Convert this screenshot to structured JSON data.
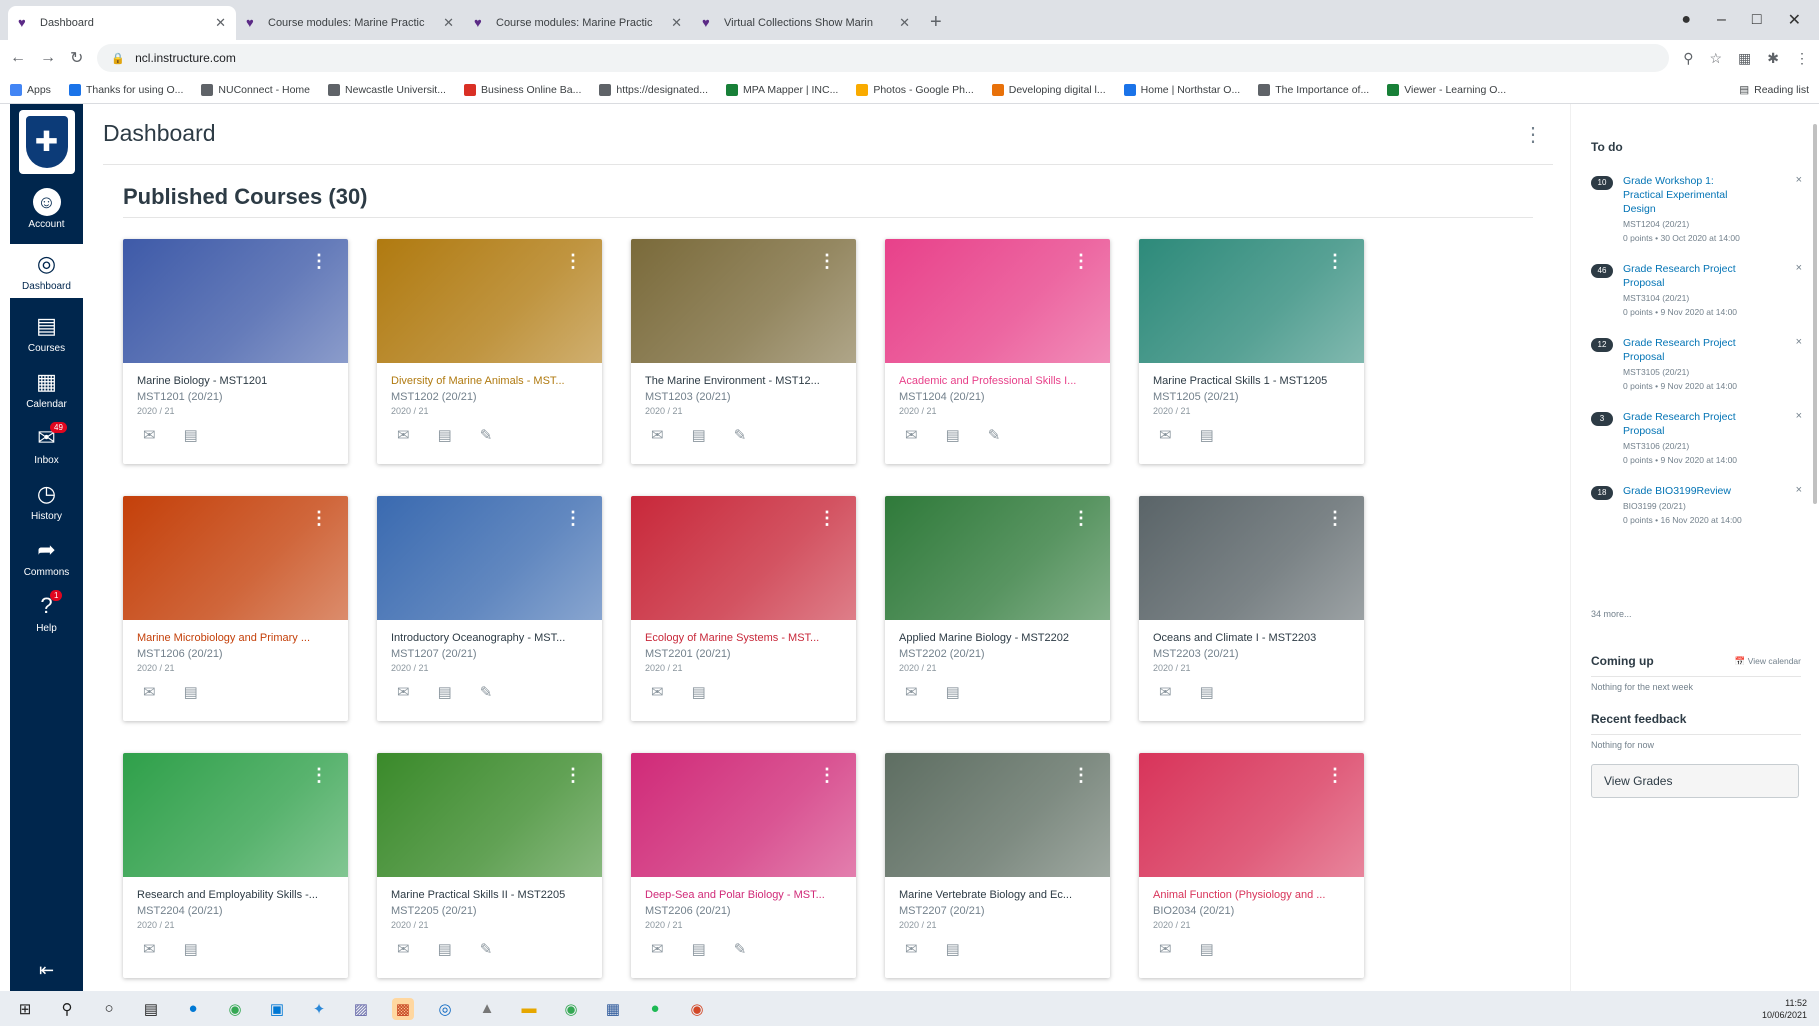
{
  "browser": {
    "tabs": [
      {
        "title": "Dashboard",
        "active": true
      },
      {
        "title": "Course modules: Marine Practic"
      },
      {
        "title": "Course modules: Marine Practic"
      },
      {
        "title": "Virtual Collections Show Marin"
      }
    ],
    "url": "ncl.instructure.com",
    "bookmarks": [
      {
        "label": "Apps",
        "color": "#4285f4"
      },
      {
        "label": "Thanks for using O...",
        "color": "#1a73e8"
      },
      {
        "label": "NUConnect - Home",
        "color": "#5f6368"
      },
      {
        "label": "Newcastle Universit...",
        "color": "#5f6368"
      },
      {
        "label": "Business Online Ba...",
        "color": "#d93025"
      },
      {
        "label": "https://designated...",
        "color": "#5f6368"
      },
      {
        "label": "MPA Mapper | INC...",
        "color": "#188038"
      },
      {
        "label": "Photos - Google Ph...",
        "color": "#f9ab00"
      },
      {
        "label": "Developing digital l...",
        "color": "#e8710a"
      },
      {
        "label": "Home | Northstar O...",
        "color": "#1a73e8"
      },
      {
        "label": "The Importance of...",
        "color": "#5f6368"
      },
      {
        "label": "Viewer - Learning O...",
        "color": "#188038"
      }
    ],
    "reading_list": "Reading list"
  },
  "global_nav": {
    "items": [
      {
        "label": "Account",
        "icon": "account-icon"
      },
      {
        "label": "Dashboard",
        "icon": "dashboard-icon",
        "active": true
      },
      {
        "label": "Courses",
        "icon": "courses-icon"
      },
      {
        "label": "Calendar",
        "icon": "calendar-icon"
      },
      {
        "label": "Inbox",
        "icon": "inbox-icon",
        "badge": "49"
      },
      {
        "label": "History",
        "icon": "history-icon"
      },
      {
        "label": "Commons",
        "icon": "commons-icon"
      },
      {
        "label": "Help",
        "icon": "help-icon",
        "badge": "1"
      }
    ]
  },
  "header": {
    "title": "Dashboard"
  },
  "section": {
    "title": "Published Courses (30)"
  },
  "courses": [
    {
      "name": "Marine Biology - MST1201",
      "code": "MST1201 (20/21)",
      "term": "2020 / 21",
      "color": "#3e5aa8",
      "name_color": "#2d3b45",
      "icons": 2
    },
    {
      "name": "Diversity of Marine Animals - MST...",
      "code": "MST1202 (20/21)",
      "term": "2020 / 21",
      "color": "#b07a10",
      "name_color": "#b07a10",
      "icons": 3
    },
    {
      "name": "The Marine Environment - MST12...",
      "code": "MST1203 (20/21)",
      "term": "2020 / 21",
      "color": "#7a6a3a",
      "name_color": "#2d3b45",
      "icons": 3
    },
    {
      "name": "Academic and Professional Skills I...",
      "code": "MST1204 (20/21)",
      "term": "2020 / 21",
      "color": "#e8418a",
      "name_color": "#e8418a",
      "icons": 3
    },
    {
      "name": "Marine Practical Skills 1 - MST1205",
      "code": "MST1205 (20/21)",
      "term": "2020 / 21",
      "color": "#2d8a7a",
      "name_color": "#2d3b45",
      "icons": 2
    },
    {
      "name": "Marine Microbiology and Primary ...",
      "code": "MST1206 (20/21)",
      "term": "2020 / 21",
      "color": "#c4400a",
      "name_color": "#c4400a",
      "icons": 2
    },
    {
      "name": "Introductory Oceanography - MST...",
      "code": "MST1207 (20/21)",
      "term": "2020 / 21",
      "color": "#3a6ab0",
      "name_color": "#2d3b45",
      "icons": 3
    },
    {
      "name": "Ecology of Marine Systems - MST...",
      "code": "MST2201 (20/21)",
      "term": "2020 / 21",
      "color": "#c8283a",
      "name_color": "#c8283a",
      "icons": 2
    },
    {
      "name": "Applied Marine Biology - MST2202",
      "code": "MST2202 (20/21)",
      "term": "2020 / 21",
      "color": "#2f7a3a",
      "name_color": "#2d3b45",
      "icons": 2
    },
    {
      "name": "Oceans and Climate I - MST2203",
      "code": "MST2203 (20/21)",
      "term": "2020 / 21",
      "color": "#5a6468",
      "name_color": "#2d3b45",
      "icons": 2
    },
    {
      "name": "Research and Employability Skills -...",
      "code": "MST2204 (20/21)",
      "term": "2020 / 21",
      "color": "#2fa04a",
      "name_color": "#2d3b45",
      "icons": 2
    },
    {
      "name": "Marine Practical Skills II - MST2205",
      "code": "MST2205 (20/21)",
      "term": "2020 / 21",
      "color": "#3a8a2a",
      "name_color": "#2d3b45",
      "icons": 3
    },
    {
      "name": "Deep-Sea and Polar Biology - MST...",
      "code": "MST2206 (20/21)",
      "term": "2020 / 21",
      "color": "#d02a78",
      "name_color": "#d02a78",
      "icons": 3
    },
    {
      "name": "Marine Vertebrate Biology and Ec...",
      "code": "MST2207 (20/21)",
      "term": "2020 / 21",
      "color": "#5e6e62",
      "name_color": "#2d3b45",
      "icons": 2
    },
    {
      "name": "Animal Function (Physiology and ...",
      "code": "BIO2034 (20/21)",
      "term": "2020 / 21",
      "color": "#d8345a",
      "name_color": "#d8345a",
      "icons": 2
    }
  ],
  "sidebar": {
    "todo_title": "To do",
    "todos": [
      {
        "count": "10",
        "title": "Grade Workshop 1: Practical Experimental Design",
        "course": "MST1204 (20/21)",
        "meta": "0 points • 30 Oct 2020 at 14:00"
      },
      {
        "count": "46",
        "title": "Grade Research Project Proposal",
        "course": "MST3104 (20/21)",
        "meta": "0 points • 9 Nov 2020 at 14:00"
      },
      {
        "count": "12",
        "title": "Grade Research Project Proposal",
        "course": "MST3105 (20/21)",
        "meta": "0 points • 9 Nov 2020 at 14:00"
      },
      {
        "count": "3",
        "title": "Grade Research Project Proposal",
        "course": "MST3106 (20/21)",
        "meta": "0 points • 9 Nov 2020 at 14:00"
      },
      {
        "count": "18",
        "title": "Grade BIO3199Review",
        "course": "BIO3199 (20/21)",
        "meta": "0 points • 16 Nov 2020 at 14:00"
      }
    ],
    "more": "34 more...",
    "coming_up_title": "Coming up",
    "view_calendar": "View calendar",
    "coming_up_text": "Nothing for the next week",
    "feedback_title": "Recent feedback",
    "feedback_text": "Nothing for now",
    "view_grades": "View Grades"
  },
  "taskbar": {
    "time": "11:52",
    "date": "10/06/2021"
  }
}
